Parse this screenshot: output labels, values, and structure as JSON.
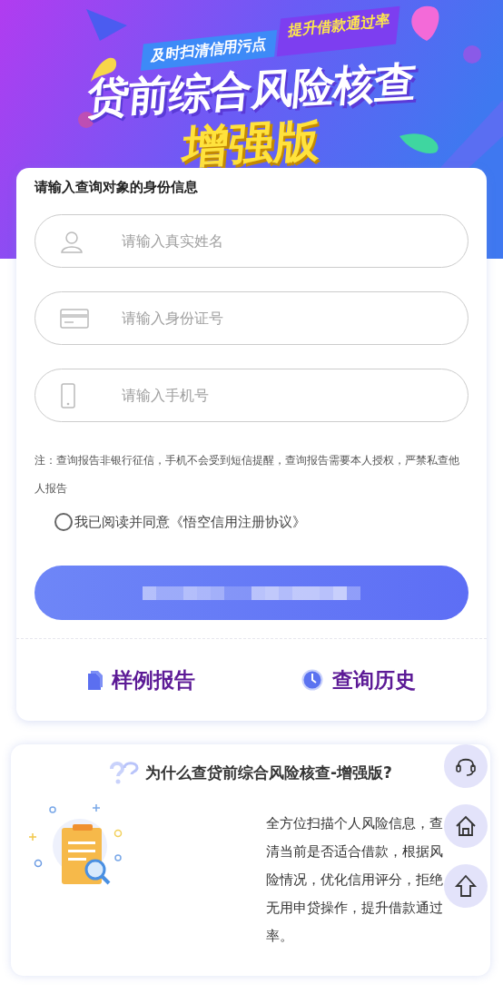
{
  "banner": {
    "tags": [
      {
        "kind": "blue",
        "text": "及时扫清信用污点"
      },
      {
        "kind": "purple",
        "text": "提升借款通过率"
      }
    ],
    "title": "贷前综合风险核查",
    "subtitle": "增强版"
  },
  "form": {
    "heading": "请输入查询对象的身份信息",
    "fields": [
      {
        "kind": "name",
        "placeholder": "请输入真实姓名"
      },
      {
        "kind": "id_card",
        "placeholder": "请输入身份证号"
      },
      {
        "kind": "phone",
        "placeholder": "请输入手机号"
      }
    ],
    "note": "注：查询报告非银行征信，手机不会受到短信提醒，查询报告需要本人授权，严禁私查他人报告",
    "agreement": {
      "checked": false,
      "text": "我已阅读并同意《悟空信用注册协议》"
    }
  },
  "links": [
    {
      "kind": "sample",
      "label": "样例报告"
    },
    {
      "kind": "history",
      "label": "查询历史"
    }
  ],
  "why": {
    "title": "为什么查贷前综合风险核查-增强版?",
    "body": "全方位扫描个人风险信息，查清当前是否适合借款，根据风险情况，优化信用评分，拒绝无用申贷操作，提升借款通过率。"
  },
  "floating_buttons": [
    {
      "kind": "support"
    },
    {
      "kind": "home"
    },
    {
      "kind": "top"
    }
  ]
}
